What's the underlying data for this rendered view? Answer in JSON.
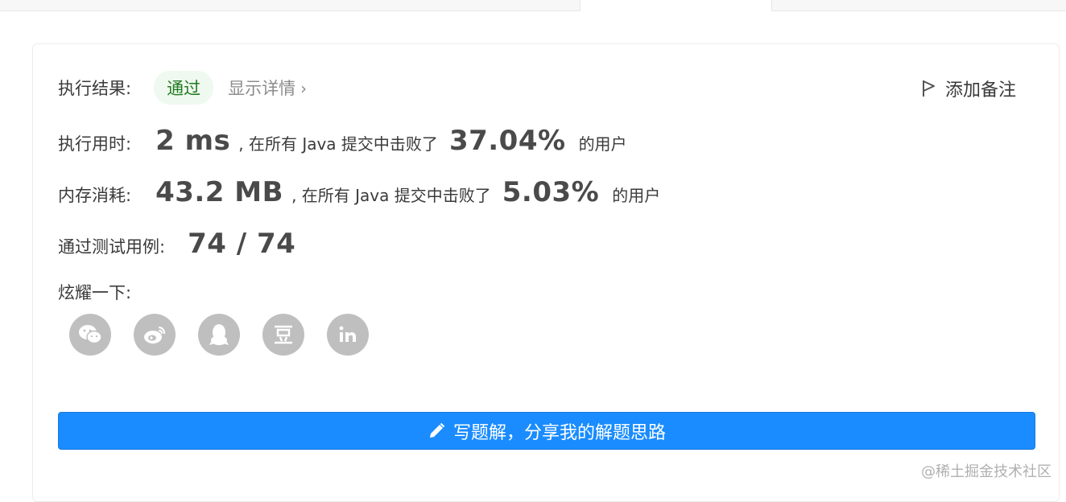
{
  "result": {
    "label": "执行结果:",
    "status": "通过",
    "detail_link": "显示详情",
    "add_note": "添加备注"
  },
  "runtime": {
    "label": "执行用时:",
    "value": "2 ms",
    "text": ", 在所有 Java 提交中击败了",
    "percent": "37.04%",
    "suffix": "的用户"
  },
  "memory": {
    "label": "内存消耗:",
    "value": "43.2 MB",
    "text": ", 在所有 Java 提交中击败了",
    "percent": "5.03%",
    "suffix": "的用户"
  },
  "tests": {
    "label": "通过测试用例:",
    "value": "74 / 74"
  },
  "share": {
    "label": "炫耀一下:",
    "icons": [
      "wechat-icon",
      "weibo-icon",
      "qq-icon",
      "douban-icon",
      "linkedin-icon"
    ]
  },
  "write_solution": {
    "label": "写题解，分享我的解题思路"
  },
  "watermark": "@稀土掘金技术社区",
  "colors": {
    "accent": "#1a8cff",
    "success_bg": "#f0f9ef",
    "success_text": "#1f7a1f",
    "icon_gray": "#bfbfbf"
  }
}
